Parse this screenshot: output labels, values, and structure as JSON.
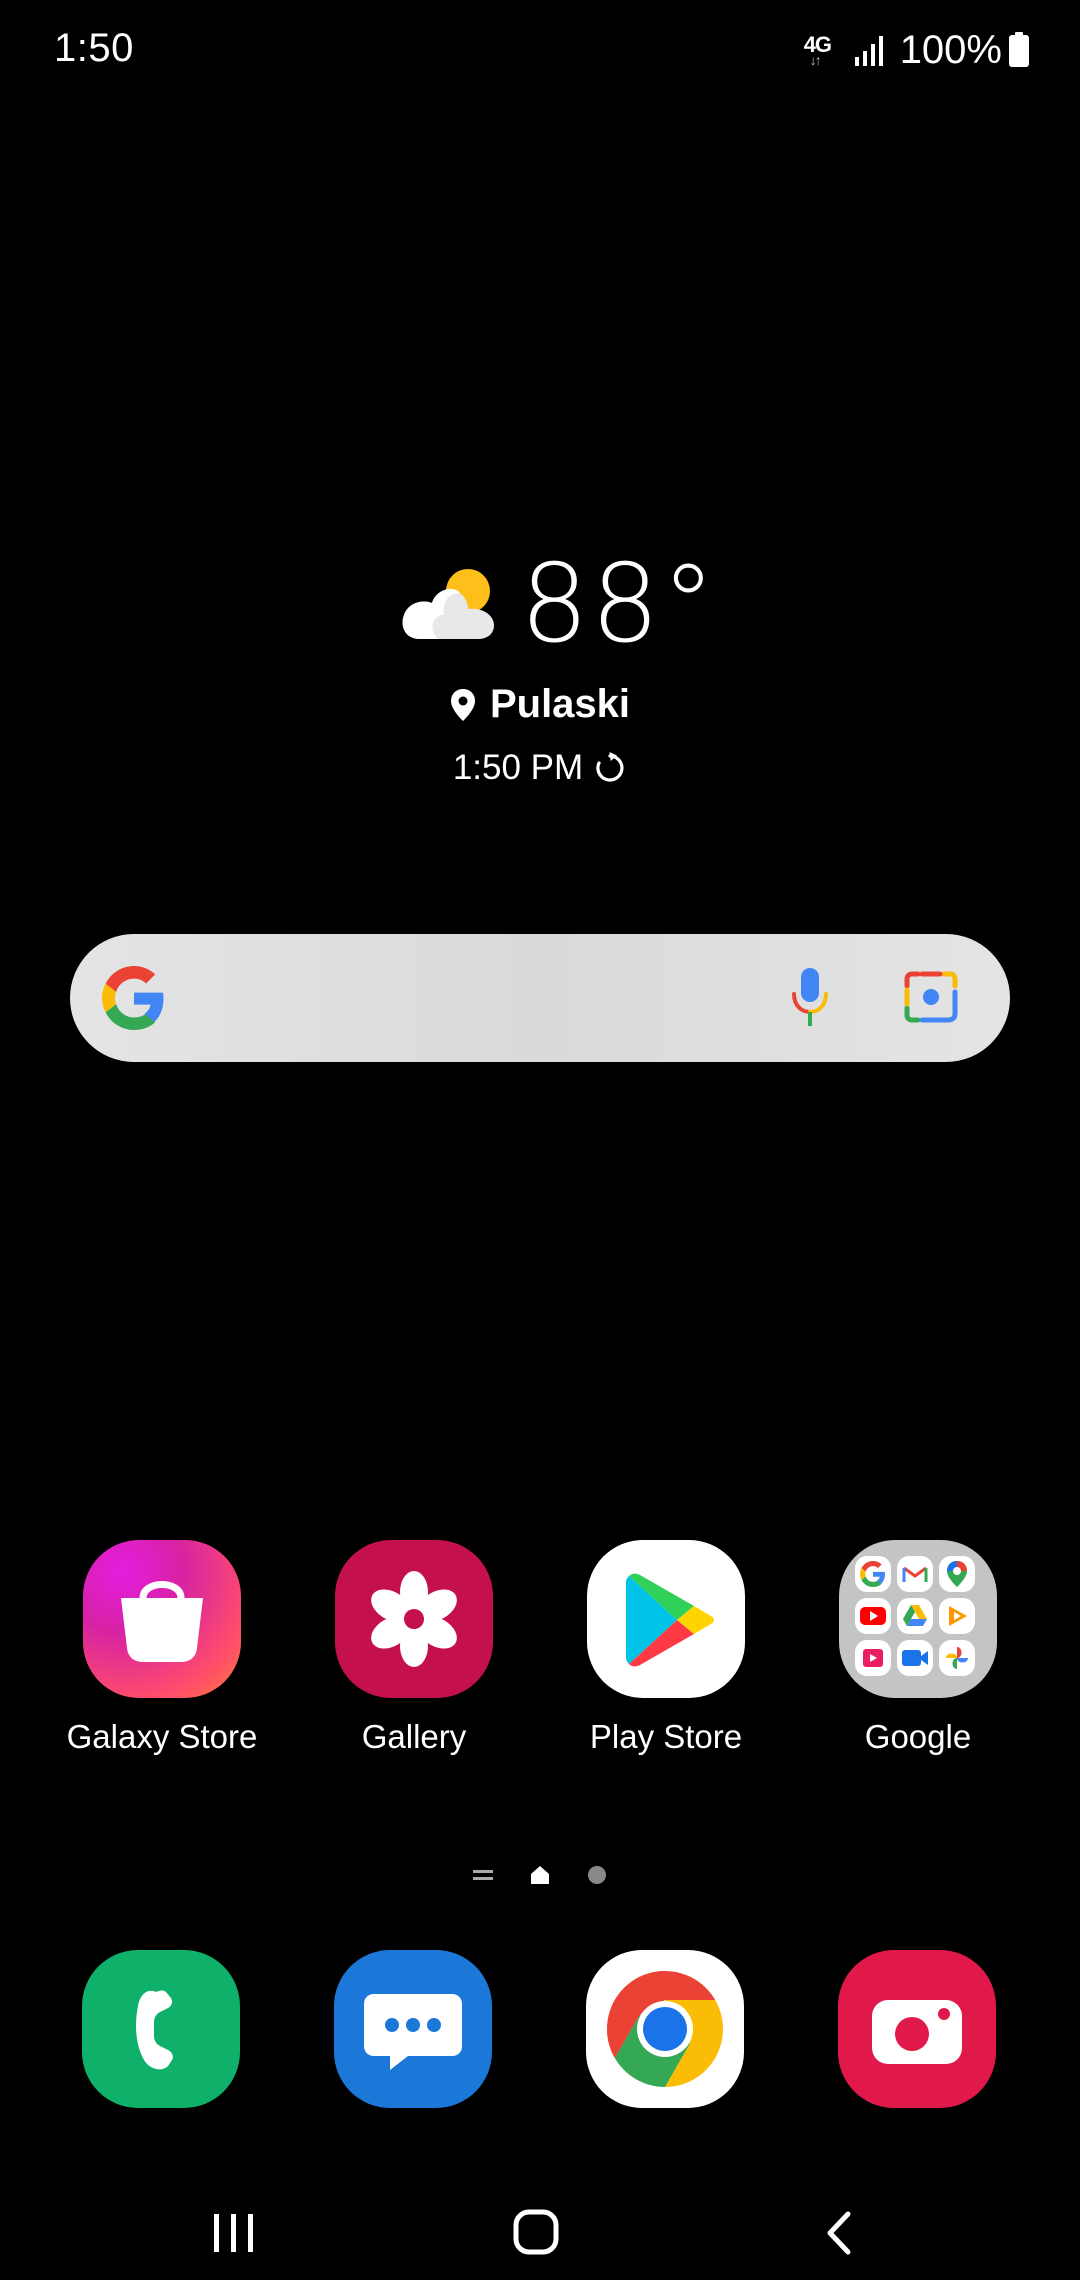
{
  "status_bar": {
    "time": "1:50",
    "network_type": "4G",
    "network_arrows": "↓↑",
    "battery_percent": "100%",
    "icons": [
      "network-type-icon",
      "signal-icon",
      "battery-icon"
    ]
  },
  "weather": {
    "condition_icon": "partly-cloudy-icon",
    "temperature": "88°",
    "location": "Pulaski",
    "time": "1:50 PM"
  },
  "search": {
    "icons": [
      "google-logo-icon",
      "microphone-icon",
      "google-lens-icon"
    ]
  },
  "apps": [
    {
      "label": "Galaxy Store",
      "icon": "galaxy-store-icon"
    },
    {
      "label": "Gallery",
      "icon": "gallery-icon"
    },
    {
      "label": "Play Store",
      "icon": "play-store-icon"
    },
    {
      "label": "Google",
      "icon": "google-folder-icon"
    }
  ],
  "google_folder_apps": [
    "google",
    "gmail",
    "maps",
    "youtube",
    "drive",
    "youtube-music",
    "play-movies",
    "meet",
    "photos"
  ],
  "page_indicator": {
    "pages": [
      "list",
      "home",
      "page"
    ],
    "current": "home"
  },
  "dock": [
    {
      "name": "phone",
      "icon": "phone-icon"
    },
    {
      "name": "messages",
      "icon": "messages-icon"
    },
    {
      "name": "chrome",
      "icon": "chrome-icon"
    },
    {
      "name": "camera",
      "icon": "camera-icon"
    }
  ],
  "nav_bar": {
    "buttons": [
      "recent-apps",
      "home",
      "back"
    ]
  },
  "colors": {
    "background": "#000000",
    "search_bar": "#e0e0e0",
    "galaxy_store": "#d722a3",
    "gallery": "#c4104f",
    "phone": "#0fb06a",
    "messages": "#1b78d8",
    "camera": "#e1194a"
  }
}
